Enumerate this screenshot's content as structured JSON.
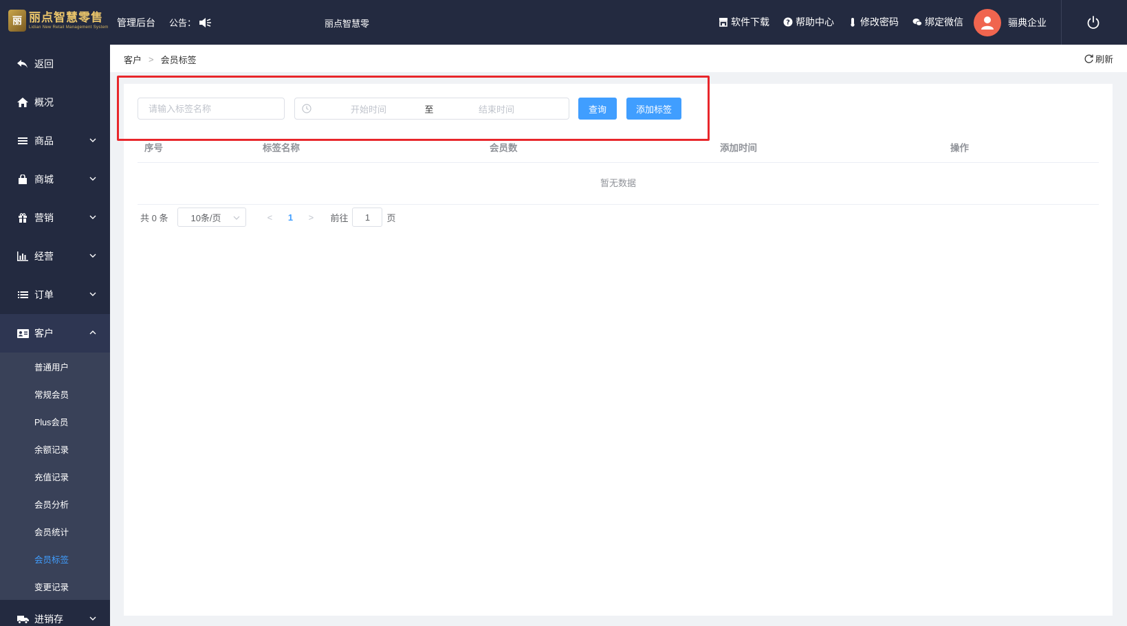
{
  "header": {
    "logo_title": "丽点智慧零售",
    "logo_subtitle": "Lidian New Retail Management System",
    "admin_label": "管理后台",
    "notice_label": "公告：",
    "marquee_text": "丽点智慧零",
    "links": [
      {
        "label": "软件下载",
        "icon": "store-icon"
      },
      {
        "label": "帮助中心",
        "icon": "question-circle-icon"
      },
      {
        "label": "修改密码",
        "icon": "thermometer-icon"
      },
      {
        "label": "绑定微信",
        "icon": "wechat-icon"
      }
    ],
    "user_name": "骊典企业"
  },
  "sidebar": {
    "items": [
      {
        "label": "返回",
        "icon": "back-arrow-icon",
        "expandable": false
      },
      {
        "label": "概况",
        "icon": "home-icon",
        "expandable": false
      },
      {
        "label": "商品",
        "icon": "list-icon",
        "expandable": true
      },
      {
        "label": "商城",
        "icon": "shopping-bag-icon",
        "expandable": true
      },
      {
        "label": "营销",
        "icon": "gift-icon",
        "expandable": true
      },
      {
        "label": "经营",
        "icon": "bar-chart-icon",
        "expandable": true
      },
      {
        "label": "订单",
        "icon": "order-list-icon",
        "expandable": true
      },
      {
        "label": "客户",
        "icon": "id-card-icon",
        "expandable": true,
        "expanded": true
      },
      {
        "label": "进销存",
        "icon": "truck-icon",
        "expandable": true
      }
    ],
    "customer_submenu": [
      {
        "label": "普通用户"
      },
      {
        "label": "常规会员"
      },
      {
        "label": "Plus会员"
      },
      {
        "label": "余额记录"
      },
      {
        "label": "充值记录"
      },
      {
        "label": "会员分析"
      },
      {
        "label": "会员统计"
      },
      {
        "label": "会员标签",
        "active": true
      },
      {
        "label": "变更记录"
      }
    ]
  },
  "breadcrumb": {
    "parent": "客户",
    "separator": ">",
    "current": "会员标签",
    "refresh_label": "刷新"
  },
  "filter": {
    "tag_placeholder": "请输入标签名称",
    "start_placeholder": "开始时间",
    "range_separator": "至",
    "end_placeholder": "结束时间",
    "query_label": "查询",
    "add_label": "添加标签"
  },
  "table": {
    "columns": [
      "序号",
      "标签名称",
      "会员数",
      "添加时间",
      "操作"
    ],
    "rows": [],
    "empty_text": "暂无数据"
  },
  "pagination": {
    "total_text": "共 0 条",
    "page_size": "10条/页",
    "prev": "<",
    "current_page": "1",
    "next": ">",
    "goto_label": "前往",
    "goto_value": "1",
    "page_suffix": "页"
  },
  "colors": {
    "sidebar_bg": "#232a40",
    "submenu_bg": "#394158",
    "primary": "#409eff",
    "highlight_box": "#e8262b",
    "avatar_bg": "#f0654f"
  }
}
